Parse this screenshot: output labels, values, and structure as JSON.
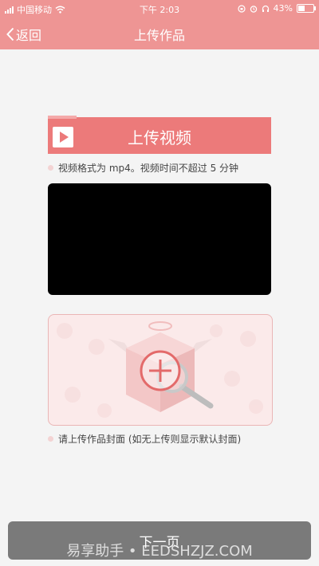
{
  "status_bar": {
    "carrier": "中国移动",
    "time": "下午 2:03",
    "battery": "43%"
  },
  "nav": {
    "back_label": "返回",
    "title": "上传作品"
  },
  "video_section": {
    "banner_label": "上传视频",
    "format_hint": "视频格式为 mp4。视频时间不超过 5 分钟"
  },
  "cover_section": {
    "hint": "请上传作品封面 (如无上传则显示默认封面)"
  },
  "footer": {
    "next_label": "下一页",
    "watermark": "易享助手 • EEDSHZJZ.COM"
  },
  "colors": {
    "header": "#ee9594",
    "banner": "#ec7a7a",
    "next_button": "#7a7a7a"
  }
}
